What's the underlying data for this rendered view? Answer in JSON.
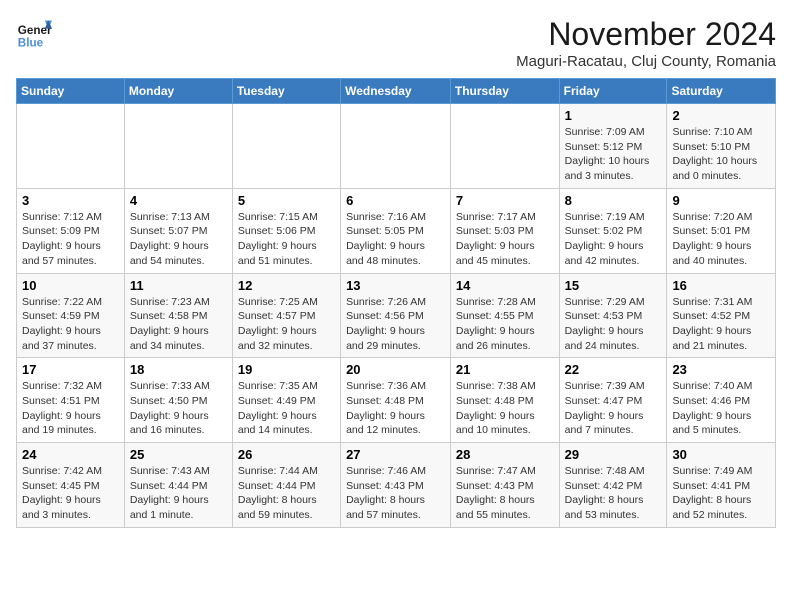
{
  "header": {
    "logo_line1": "General",
    "logo_line2": "Blue",
    "title": "November 2024",
    "subtitle": "Maguri-Racatau, Cluj County, Romania"
  },
  "weekdays": [
    "Sunday",
    "Monday",
    "Tuesday",
    "Wednesday",
    "Thursday",
    "Friday",
    "Saturday"
  ],
  "weeks": [
    [
      {
        "day": "",
        "detail": ""
      },
      {
        "day": "",
        "detail": ""
      },
      {
        "day": "",
        "detail": ""
      },
      {
        "day": "",
        "detail": ""
      },
      {
        "day": "",
        "detail": ""
      },
      {
        "day": "1",
        "detail": "Sunrise: 7:09 AM\nSunset: 5:12 PM\nDaylight: 10 hours\nand 3 minutes."
      },
      {
        "day": "2",
        "detail": "Sunrise: 7:10 AM\nSunset: 5:10 PM\nDaylight: 10 hours\nand 0 minutes."
      }
    ],
    [
      {
        "day": "3",
        "detail": "Sunrise: 7:12 AM\nSunset: 5:09 PM\nDaylight: 9 hours\nand 57 minutes."
      },
      {
        "day": "4",
        "detail": "Sunrise: 7:13 AM\nSunset: 5:07 PM\nDaylight: 9 hours\nand 54 minutes."
      },
      {
        "day": "5",
        "detail": "Sunrise: 7:15 AM\nSunset: 5:06 PM\nDaylight: 9 hours\nand 51 minutes."
      },
      {
        "day": "6",
        "detail": "Sunrise: 7:16 AM\nSunset: 5:05 PM\nDaylight: 9 hours\nand 48 minutes."
      },
      {
        "day": "7",
        "detail": "Sunrise: 7:17 AM\nSunset: 5:03 PM\nDaylight: 9 hours\nand 45 minutes."
      },
      {
        "day": "8",
        "detail": "Sunrise: 7:19 AM\nSunset: 5:02 PM\nDaylight: 9 hours\nand 42 minutes."
      },
      {
        "day": "9",
        "detail": "Sunrise: 7:20 AM\nSunset: 5:01 PM\nDaylight: 9 hours\nand 40 minutes."
      }
    ],
    [
      {
        "day": "10",
        "detail": "Sunrise: 7:22 AM\nSunset: 4:59 PM\nDaylight: 9 hours\nand 37 minutes."
      },
      {
        "day": "11",
        "detail": "Sunrise: 7:23 AM\nSunset: 4:58 PM\nDaylight: 9 hours\nand 34 minutes."
      },
      {
        "day": "12",
        "detail": "Sunrise: 7:25 AM\nSunset: 4:57 PM\nDaylight: 9 hours\nand 32 minutes."
      },
      {
        "day": "13",
        "detail": "Sunrise: 7:26 AM\nSunset: 4:56 PM\nDaylight: 9 hours\nand 29 minutes."
      },
      {
        "day": "14",
        "detail": "Sunrise: 7:28 AM\nSunset: 4:55 PM\nDaylight: 9 hours\nand 26 minutes."
      },
      {
        "day": "15",
        "detail": "Sunrise: 7:29 AM\nSunset: 4:53 PM\nDaylight: 9 hours\nand 24 minutes."
      },
      {
        "day": "16",
        "detail": "Sunrise: 7:31 AM\nSunset: 4:52 PM\nDaylight: 9 hours\nand 21 minutes."
      }
    ],
    [
      {
        "day": "17",
        "detail": "Sunrise: 7:32 AM\nSunset: 4:51 PM\nDaylight: 9 hours\nand 19 minutes."
      },
      {
        "day": "18",
        "detail": "Sunrise: 7:33 AM\nSunset: 4:50 PM\nDaylight: 9 hours\nand 16 minutes."
      },
      {
        "day": "19",
        "detail": "Sunrise: 7:35 AM\nSunset: 4:49 PM\nDaylight: 9 hours\nand 14 minutes."
      },
      {
        "day": "20",
        "detail": "Sunrise: 7:36 AM\nSunset: 4:48 PM\nDaylight: 9 hours\nand 12 minutes."
      },
      {
        "day": "21",
        "detail": "Sunrise: 7:38 AM\nSunset: 4:48 PM\nDaylight: 9 hours\nand 10 minutes."
      },
      {
        "day": "22",
        "detail": "Sunrise: 7:39 AM\nSunset: 4:47 PM\nDaylight: 9 hours\nand 7 minutes."
      },
      {
        "day": "23",
        "detail": "Sunrise: 7:40 AM\nSunset: 4:46 PM\nDaylight: 9 hours\nand 5 minutes."
      }
    ],
    [
      {
        "day": "24",
        "detail": "Sunrise: 7:42 AM\nSunset: 4:45 PM\nDaylight: 9 hours\nand 3 minutes."
      },
      {
        "day": "25",
        "detail": "Sunrise: 7:43 AM\nSunset: 4:44 PM\nDaylight: 9 hours\nand 1 minute."
      },
      {
        "day": "26",
        "detail": "Sunrise: 7:44 AM\nSunset: 4:44 PM\nDaylight: 8 hours\nand 59 minutes."
      },
      {
        "day": "27",
        "detail": "Sunrise: 7:46 AM\nSunset: 4:43 PM\nDaylight: 8 hours\nand 57 minutes."
      },
      {
        "day": "28",
        "detail": "Sunrise: 7:47 AM\nSunset: 4:43 PM\nDaylight: 8 hours\nand 55 minutes."
      },
      {
        "day": "29",
        "detail": "Sunrise: 7:48 AM\nSunset: 4:42 PM\nDaylight: 8 hours\nand 53 minutes."
      },
      {
        "day": "30",
        "detail": "Sunrise: 7:49 AM\nSunset: 4:41 PM\nDaylight: 8 hours\nand 52 minutes."
      }
    ]
  ]
}
